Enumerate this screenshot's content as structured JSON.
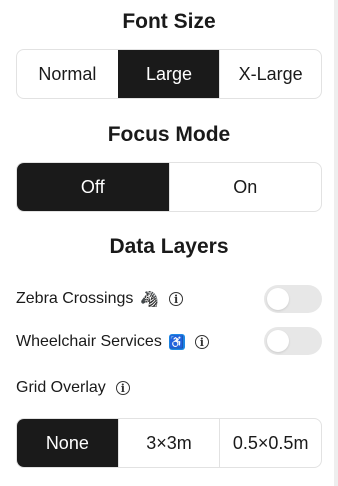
{
  "font_size": {
    "title": "Font Size",
    "options": [
      "Normal",
      "Large",
      "X-Large"
    ],
    "selected": "Large"
  },
  "focus_mode": {
    "title": "Focus Mode",
    "options": [
      "Off",
      "On"
    ],
    "selected": "Off"
  },
  "data_layers": {
    "title": "Data Layers",
    "zebra": {
      "label": "Zebra Crossings",
      "icon": "zebra-emoji-icon",
      "enabled": false
    },
    "wheelchair": {
      "label": "Wheelchair Services",
      "icon": "wheelchair-icon",
      "enabled": false
    },
    "grid": {
      "label": "Grid Overlay",
      "options": [
        "None",
        "3×3m",
        "0.5×0.5m"
      ],
      "selected": "None"
    }
  },
  "colors": {
    "active": "#1a1a1a",
    "toggle_off": "#e7e7e7",
    "accessibility": "#1e88e5"
  }
}
